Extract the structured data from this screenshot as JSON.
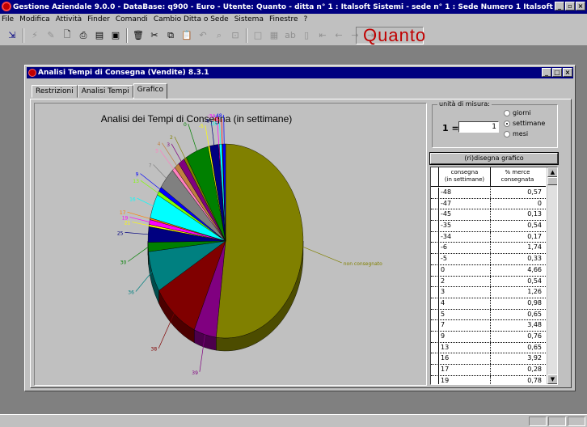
{
  "app": {
    "title": "Gestione Aziendale 9.0.0 - DataBase: q900 - Euro - Utente: Quanto - ditta n° 1 : Italsoft Sistemi - sede n° 1 : Sede Numero 1 Italsoft",
    "brand": "Quanto",
    "brand_color": "#c00000"
  },
  "menu": [
    "File",
    "Modifica",
    "Attività",
    "Finder",
    "Comandi",
    "Cambio Ditta o Sede",
    "Sistema",
    "Finestre",
    "?"
  ],
  "window": {
    "title": "Analisi Tempi di Consegna (Vendite) 8.3.1",
    "tabs": [
      "Restrizioni",
      "Analisi Tempi",
      "Grafico"
    ],
    "active_tab": "Grafico"
  },
  "units": {
    "label": "unità di misura:",
    "eq_label": "1 =",
    "value": "1",
    "options": [
      "giorni",
      "settimane",
      "mesi"
    ],
    "selected": "settimane"
  },
  "draw_button": "(ri)disegna grafico",
  "table": {
    "headers": [
      "consegna\n(in settimane)",
      "% merce\nconsegnata"
    ],
    "rows": [
      [
        "-48",
        "0,57"
      ],
      [
        "-47",
        "0"
      ],
      [
        "-45",
        "0,13"
      ],
      [
        "-35",
        "0,54"
      ],
      [
        "-34",
        "0,17"
      ],
      [
        "-6",
        "1,74"
      ],
      [
        "-5",
        "0,33"
      ],
      [
        "0",
        "4,66"
      ],
      [
        "2",
        "0,54"
      ],
      [
        "3",
        "1,26"
      ],
      [
        "4",
        "0,98"
      ],
      [
        "5",
        "0,65"
      ],
      [
        "7",
        "3,48"
      ],
      [
        "9",
        "0,76"
      ],
      [
        "13",
        "0,65"
      ],
      [
        "16",
        "3,92"
      ],
      [
        "17",
        "0,28"
      ],
      [
        "19",
        "0,78"
      ],
      [
        "21",
        "0,33"
      ]
    ]
  },
  "chart_data": {
    "type": "pie",
    "title": "Analisi dei Tempi di Consegna (in settimane)",
    "labels": [
      "non consegnato",
      "39",
      "38",
      "36",
      "30",
      "25",
      "21",
      "19",
      "17",
      "16",
      "13",
      "9",
      "7",
      "5",
      "4",
      "3",
      "2",
      "0",
      "-5",
      "-6",
      "-34",
      "-35",
      "-45",
      "-48"
    ],
    "values": [
      50.0,
      4.5,
      9.5,
      6.5,
      1.5,
      2.5,
      0.33,
      0.78,
      0.28,
      3.92,
      0.65,
      0.76,
      3.48,
      0.65,
      0.98,
      1.26,
      0.54,
      4.66,
      0.33,
      1.74,
      0.17,
      0.54,
      0.13,
      0.57
    ],
    "colors": [
      "#808000",
      "#800080",
      "#800000",
      "#008080",
      "#008000",
      "#000080",
      "#ffff00",
      "#ff00ff",
      "#ff8000",
      "#00ffff",
      "#80ff00",
      "#0000ff",
      "#808080",
      "#ff80c0",
      "#c08040",
      "#800080",
      "#808000",
      "#008000",
      "#ffff00",
      "#000080",
      "#ff00ff",
      "#00ffff",
      "#ff0000",
      "#0000ff"
    ]
  }
}
